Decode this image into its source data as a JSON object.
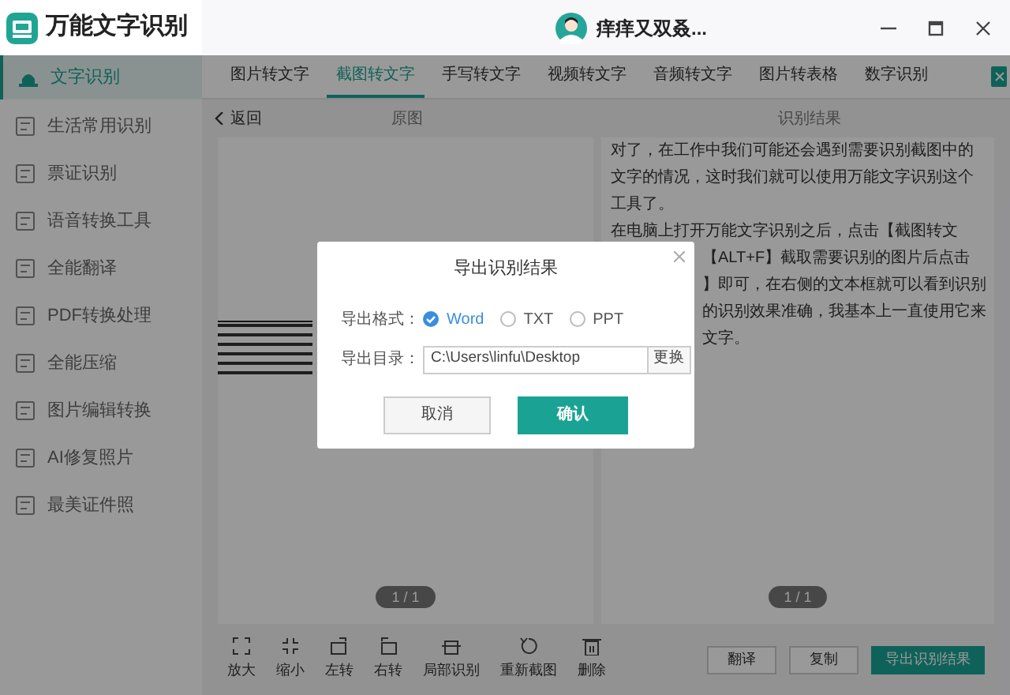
{
  "window": {
    "app_name": "万能文字识别",
    "user_name": "痒痒又双叒..."
  },
  "sidebar": {
    "items": [
      {
        "label": "文字识别",
        "selected": true
      },
      {
        "label": "生活常用识别",
        "selected": false
      },
      {
        "label": "票证识别",
        "selected": false
      },
      {
        "label": "语音转换工具",
        "selected": false
      },
      {
        "label": "全能翻译",
        "selected": false
      },
      {
        "label": "PDF转换处理",
        "selected": false
      },
      {
        "label": "全能压缩",
        "selected": false
      },
      {
        "label": "图片编辑转换",
        "selected": false
      },
      {
        "label": "AI修复照片",
        "selected": false
      },
      {
        "label": "最美证件照",
        "selected": false
      }
    ]
  },
  "tabs": [
    {
      "label": "图片转文字",
      "selected": false
    },
    {
      "label": "截图转文字",
      "selected": true
    },
    {
      "label": "手写转文字",
      "selected": false
    },
    {
      "label": "视频转文字",
      "selected": false
    },
    {
      "label": "音频转文字",
      "selected": false
    },
    {
      "label": "图片转表格",
      "selected": false
    },
    {
      "label": "数字识别",
      "selected": false
    }
  ],
  "header": {
    "back": "返回",
    "original_title": "原图",
    "result_title": "识别结果"
  },
  "result_lines": [
    "对了，在工作中我们可能还会遇到需要识别截图中的",
    "文字的情况，这时我们就可以使用万能文字识别这个",
    "工具了。",
    "在电脑上打开万能文字识别之后，点击【截图转文"
  ],
  "result_fragments": [
    "【ALT+F】截取需要识别的图片后点击",
    "】即可，在右侧的文本框就可以看到识别",
    "的识别效果准确，我基本上一直使用它来",
    "文字。"
  ],
  "original_pager": "1 / 1",
  "result_pager": "1 / 1",
  "toolbar": [
    "放大",
    "缩小",
    "左转",
    "右转",
    "局部识别",
    "重新截图",
    "删除"
  ],
  "actions": [
    {
      "label": "翻译",
      "kind": "secondary"
    },
    {
      "label": "复制",
      "kind": "secondary"
    },
    {
      "label": "导出识别结果",
      "kind": "primary"
    }
  ],
  "dialog": {
    "title": "导出识别结果",
    "format_label": "导出格式：",
    "formats": [
      {
        "label": "Word",
        "selected": true
      },
      {
        "label": "TXT",
        "selected": false
      },
      {
        "label": "PPT",
        "selected": false
      }
    ],
    "dir_label": "导出目录：",
    "dir_value": "C:\\Users\\linfu\\Desktop",
    "change": "更换",
    "cancel": "取消",
    "confirm": "确认"
  }
}
